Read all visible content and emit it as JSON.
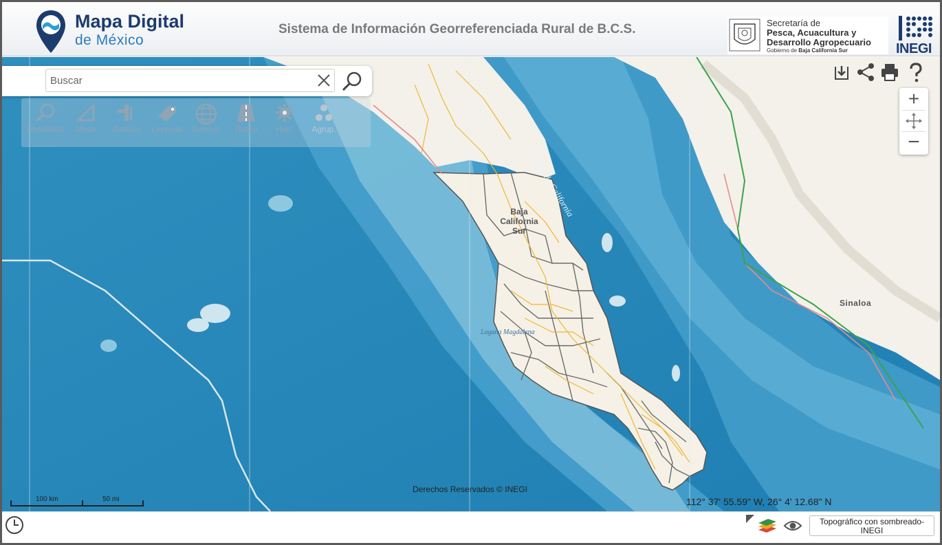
{
  "header": {
    "logo_title": "Mapa Digital",
    "logo_subtitle": "de México",
    "title": "Sistema de Información Georreferenciada Rural de B.C.S.",
    "secretaria": {
      "line1": "Secretaría de",
      "line2": "Pesca, Acuacultura y",
      "line3": "Desarrollo Agropecuario",
      "line4_prefix": "Gobierno de ",
      "line4_bold": "Baja California Sur"
    },
    "inegi_logo": "INEGI"
  },
  "search": {
    "placeholder": "Buscar",
    "value": ""
  },
  "toolbar": {
    "items": [
      {
        "label": "Resultado",
        "icon": "magnifier-icon"
      },
      {
        "label": "Medir",
        "icon": "ruler-icon"
      },
      {
        "label": "Análisis",
        "icon": "analysis-icon"
      },
      {
        "label": "Leyenda",
        "icon": "tag-icon"
      },
      {
        "label": "Georref.",
        "icon": "globe-icon"
      },
      {
        "label": "Ruteo",
        "icon": "road-icon"
      },
      {
        "label": "Herr.",
        "icon": "gear-icon"
      },
      {
        "label": "Agrup.",
        "icon": "cluster-icon"
      }
    ]
  },
  "map": {
    "labels": {
      "golfo": "Golfo de California",
      "state": "Baja California Sur",
      "state_l1": "Baja",
      "state_l2": "California",
      "state_l3": "Sur",
      "laguna": "Laguna Magdalena",
      "sinaloa": "Sinaloa"
    },
    "copyright": "Derechos Reservados © INEGI",
    "coordinates": "112° 37' 55.59\" W, 26° 4' 12.68\" N",
    "scale_km": "100 km",
    "scale_mi": "50 mi"
  },
  "controls": {
    "zoom_in": "+",
    "zoom_out": "−"
  },
  "bottom": {
    "basemap_label": "Topográfico con sombreado-INEGI"
  },
  "colors": {
    "brand_dark": "#1d3c6e",
    "brand_blue": "#2a7bc0",
    "deep_ocean": "#2f8fbe",
    "shelf": "#7cc0db",
    "land": "#f3f1ea",
    "road": "#f2b634",
    "border": "#e88a8a",
    "municipio": "#6b6b6b"
  }
}
